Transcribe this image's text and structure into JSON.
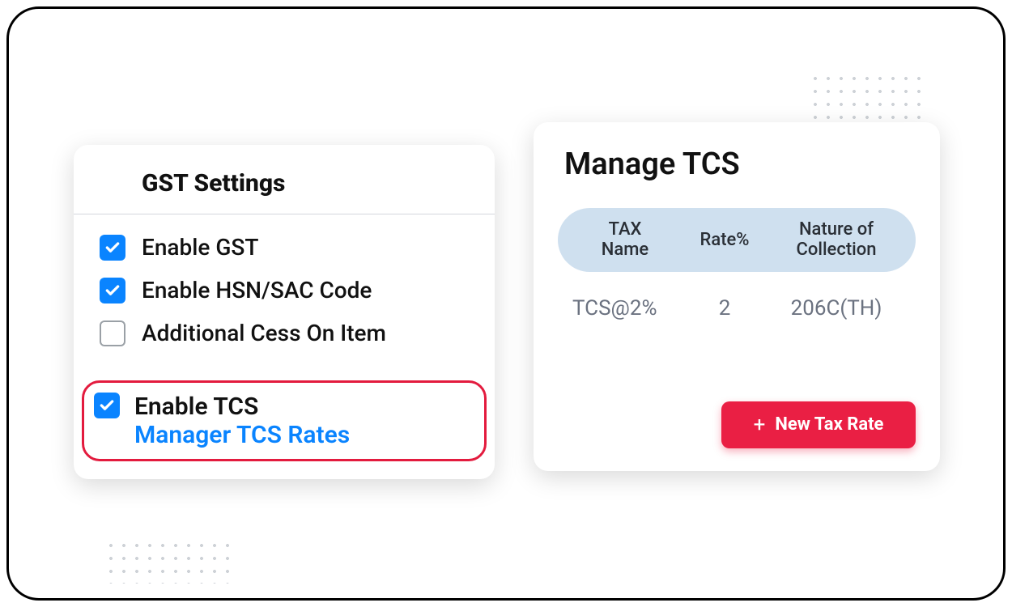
{
  "settings": {
    "title": "GST Settings",
    "items": [
      {
        "label": "Enable GST",
        "checked": true
      },
      {
        "label": "Enable HSN/SAC Code",
        "checked": true
      },
      {
        "label": "Additional Cess On Item",
        "checked": false
      }
    ],
    "highlight": {
      "checked": true,
      "label": "Enable TCS",
      "link": "Manager TCS Rates"
    }
  },
  "manage": {
    "title": "Manage TCS",
    "columns": {
      "c1a": "TAX",
      "c1b": "Name",
      "c2": "Rate%",
      "c3a": "Nature of",
      "c3b": "Collection"
    },
    "rows": [
      {
        "name": "TCS@2%",
        "rate": "2",
        "nature": "206C(TH)"
      }
    ],
    "button": "New Tax Rate"
  }
}
